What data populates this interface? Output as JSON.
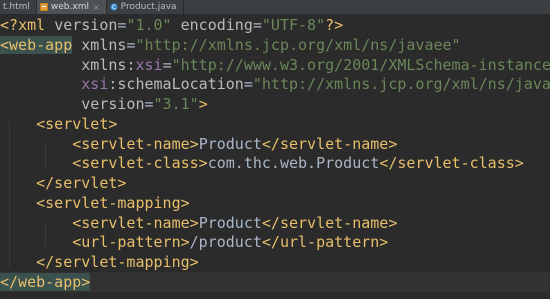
{
  "tabs": [
    {
      "label": "t.html",
      "active": false,
      "icon": "html-file-icon"
    },
    {
      "label": "web.xml",
      "active": true,
      "icon": "xml-file-icon"
    },
    {
      "label": "Product.java",
      "active": false,
      "icon": "java-class-icon"
    }
  ],
  "code": {
    "line1": {
      "open": "<?",
      "kw": "xml",
      "a1": "version",
      "v1": "\"1.0\"",
      "a2": "encoding",
      "v2": "\"UTF-8\"",
      "close": "?>"
    },
    "line2": {
      "tag": "<web-app",
      "attr": "xmlns",
      "val": "\"http://xmlns.jcp.org/xml/ns/javaee\""
    },
    "line3": {
      "attr": "xmlns",
      "ns": "xsi",
      "val": "\"http://www.w3.org/2001/XMLSchema-instance\""
    },
    "line4": {
      "ns": "xsi",
      "attr": "schemaLocation",
      "val": "\"http://xmlns.jcp.org/xml/ns/javae"
    },
    "line5": {
      "attr": "version",
      "val": "\"3.1\"",
      "close": ">"
    },
    "line6": {
      "tag": "<servlet>"
    },
    "line7": {
      "open": "<servlet-name>",
      "text": "Product",
      "close": "</servlet-name>"
    },
    "line8": {
      "open": "<servlet-class>",
      "text": "com.thc.web.Product",
      "close": "</servlet-class>"
    },
    "line9": {
      "tag": "</servlet>"
    },
    "line10": {
      "tag": "<servlet-mapping>"
    },
    "line11": {
      "open": "<servlet-name>",
      "text": "Product",
      "close": "</servlet-name>"
    },
    "line12": {
      "open": "<url-pattern>",
      "text": "/product",
      "close": "</url-pattern>"
    },
    "line13": {
      "tag": "</servlet-mapping>"
    },
    "line14": {
      "tag": "</web-app>"
    }
  },
  "colors": {
    "background": "#2b2b2b",
    "tag": "#e8bf6a",
    "attribute": "#bababa",
    "namespace": "#9876aa",
    "string": "#6a8759",
    "text": "#a9b7c6",
    "match_highlight": "#3b514d"
  }
}
